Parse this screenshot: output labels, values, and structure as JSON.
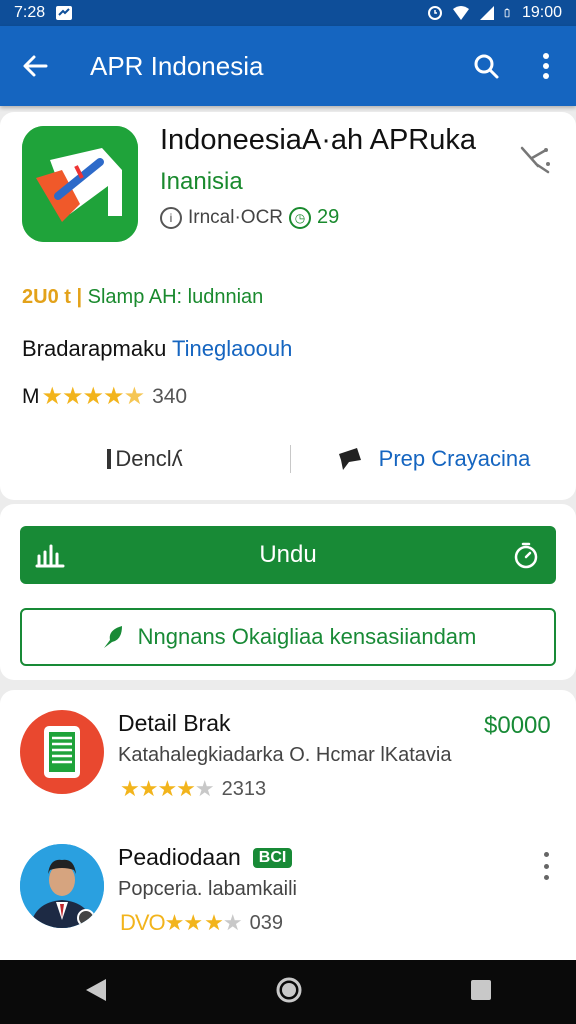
{
  "status_bar": {
    "time_left": "7:28",
    "time_right": "19:00"
  },
  "app_bar": {
    "title": "APR Indonesia"
  },
  "app": {
    "name": "IndoneesiaA·ah APRuka",
    "developer": "Inanisia",
    "meta_text": "Irncal·OCR",
    "meta_number": "29",
    "tagline_prefix": "2U0 t |",
    "tagline": "Slamp AH: ludnnian",
    "category_label": "Bradarapmaku",
    "category_link": "Tineglaoouh",
    "rating_prefix": "M",
    "rating_value": 4.5,
    "rating_count": "340",
    "action_left": "Denclʎ",
    "action_right": "Prep Crayacina"
  },
  "buttons": {
    "download": "Undu",
    "secondary": "Nngnans Okaigliaa kensasiiandam"
  },
  "list": [
    {
      "title": "Detail Brak",
      "subtitle": "Katahalegkiadarka O. Hcmar lKatavia",
      "rating": 4,
      "count": "2313",
      "price": "$0000"
    },
    {
      "title": "Peadiodaan",
      "badge": "BCI",
      "subtitle": "Popceria. labamkaili",
      "rating_prefix": "DVO★★",
      "rating": 3.5,
      "count": "039"
    }
  ],
  "colors": {
    "app_bar": "#1565c0",
    "status_bar": "#0e4e99",
    "accent_green": "#188a36",
    "link_blue": "#1565c0",
    "star": "#f2b41c"
  }
}
